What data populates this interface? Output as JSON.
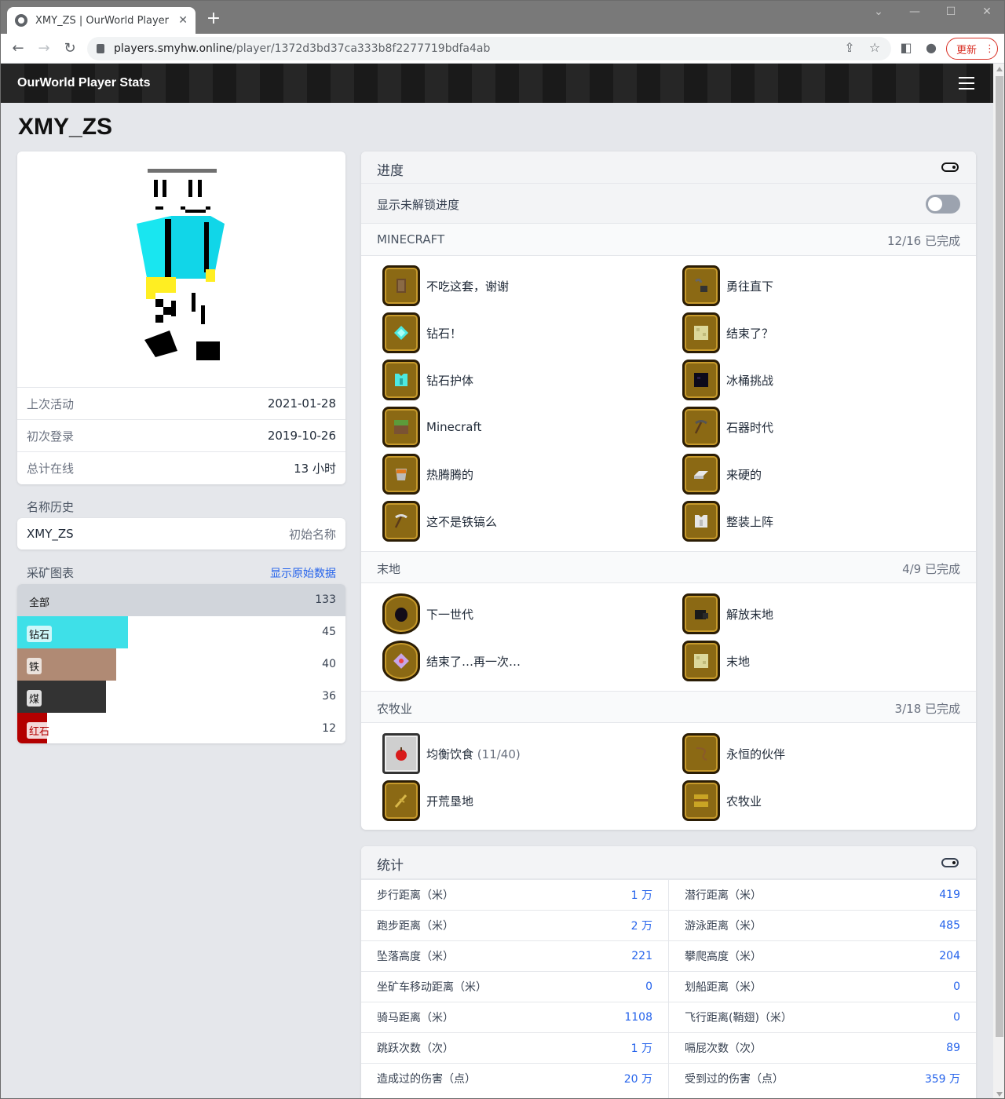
{
  "browser": {
    "tab_title": "XMY_ZS | OurWorld Player Sta",
    "url_domain": "players.smyhw.online",
    "url_path": "/player/1372d3bd37ca333b8f2277719bdfa4ab",
    "update_label": "更新"
  },
  "navbar": {
    "brand": "OurWorld Player Stats"
  },
  "player": {
    "name": "XMY_ZS",
    "info": [
      {
        "label": "上次活动",
        "value": "2021-01-28"
      },
      {
        "label": "初次登录",
        "value": "2019-10-26"
      },
      {
        "label": "总计在线",
        "value": "13 小时"
      }
    ]
  },
  "name_history": {
    "title": "名称历史",
    "rows": [
      {
        "name": "XMY_ZS",
        "note": "初始名称"
      }
    ]
  },
  "mining": {
    "title": "采矿图表",
    "raw_link": "显示原始数据",
    "total": {
      "label": "全部",
      "value": "133"
    },
    "ores": [
      {
        "label": "钻石",
        "value": "45",
        "fraction": 0.338,
        "color": "#3ee0e8"
      },
      {
        "label": "铁",
        "value": "40",
        "fraction": 0.301,
        "color": "#b08a74"
      },
      {
        "label": "煤",
        "value": "36",
        "fraction": 0.271,
        "color": "#333333"
      },
      {
        "label": "红石",
        "value": "12",
        "fraction": 0.09,
        "color": "#b30000"
      }
    ]
  },
  "advancements": {
    "title": "进度",
    "show_locked_label": "显示未解锁进度",
    "sections": [
      {
        "name": "MINECRAFT",
        "progress": "12/16 已完成",
        "items": [
          {
            "label": "不吃这套，谢谢",
            "icon": "shield-icon"
          },
          {
            "label": "勇往直下",
            "icon": "flint-and-steel-icon"
          },
          {
            "label": "钻石！",
            "icon": "diamond-icon"
          },
          {
            "label": "结束了？",
            "icon": "end-stone-icon"
          },
          {
            "label": "钻石护体",
            "icon": "diamond-chestplate-icon"
          },
          {
            "label": "冰桶挑战",
            "icon": "obsidian-icon"
          },
          {
            "label": "Minecraft",
            "icon": "grass-block-icon"
          },
          {
            "label": "石器时代",
            "icon": "stone-pickaxe-icon"
          },
          {
            "label": "热腾腾的",
            "icon": "lava-bucket-icon"
          },
          {
            "label": "来硬的",
            "icon": "iron-ingot-icon"
          },
          {
            "label": "这不是铁镐么",
            "icon": "iron-pickaxe-icon"
          },
          {
            "label": "整装上阵",
            "icon": "iron-chestplate-icon"
          }
        ]
      },
      {
        "name": "末地",
        "progress": "4/9 已完成",
        "items": [
          {
            "label": "下一世代",
            "icon": "dragon-egg-icon"
          },
          {
            "label": "解放末地",
            "icon": "dragon-head-icon"
          },
          {
            "label": "结束了…再一次…",
            "icon": "end-crystal-icon"
          },
          {
            "label": "末地",
            "icon": "end-stone-icon"
          }
        ]
      },
      {
        "name": "农牧业",
        "progress": "3/18 已完成",
        "items": [
          {
            "label": "均衡饮食",
            "progress": "(11/40)",
            "icon": "apple-icon"
          },
          {
            "label": "永恒的伙伴",
            "icon": "lead-icon"
          },
          {
            "label": "开荒垦地",
            "icon": "wheat-icon"
          },
          {
            "label": "农牧业",
            "icon": "hay-bale-icon"
          }
        ]
      }
    ]
  },
  "stats": {
    "title": "统计",
    "rows": [
      {
        "label": "步行距离（米）",
        "value": "1 万"
      },
      {
        "label": "潜行距离（米）",
        "value": "419"
      },
      {
        "label": "跑步距离（米）",
        "value": "2 万"
      },
      {
        "label": "游泳距离（米）",
        "value": "485"
      },
      {
        "label": "坠落高度（米）",
        "value": "221"
      },
      {
        "label": "攀爬高度（米）",
        "value": "204"
      },
      {
        "label": "坐矿车移动距离（米）",
        "value": "0"
      },
      {
        "label": "划船距离（米）",
        "value": "0"
      },
      {
        "label": "骑马距离（米）",
        "value": "1108"
      },
      {
        "label": "飞行距离(鞘翅)（米）",
        "value": "0"
      },
      {
        "label": "跳跃次数（次）",
        "value": "1 万"
      },
      {
        "label": "嗝屁次数（次）",
        "value": "89"
      },
      {
        "label": "造成过的伤害（点）",
        "value": "20 万"
      },
      {
        "label": "受到过的伤害（点）",
        "value": "359 万"
      }
    ]
  }
}
